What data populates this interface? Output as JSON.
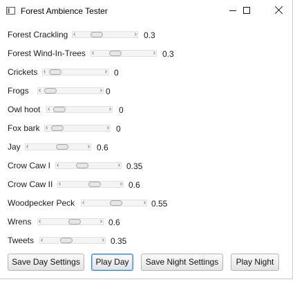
{
  "window": {
    "title": "Forest Ambience Tester",
    "controls": {
      "minimize": "minimize-icon",
      "maximize": "maximize-icon",
      "close": "close-icon"
    }
  },
  "sliders": [
    {
      "label": "Forest Crackling",
      "value": "0.3"
    },
    {
      "label": "Forest Wind-In-Trees",
      "value": "0.3"
    },
    {
      "label": "Crickets",
      "value": "0"
    },
    {
      "label": "Frogs",
      "value": "0"
    },
    {
      "label": "Owl hoot",
      "value": "0"
    },
    {
      "label": "Fox bark",
      "value": "0"
    },
    {
      "label": "Jay",
      "value": "0.6"
    },
    {
      "label": "Crow Caw I",
      "value": "0.35"
    },
    {
      "label": "Crow Caw II",
      "value": "0.6"
    },
    {
      "label": "Woodpecker Peck",
      "value": "0.55"
    },
    {
      "label": "Wrens",
      "value": "0.6"
    },
    {
      "label": "Tweets",
      "value": "0.35"
    }
  ],
  "buttons": {
    "save_day": "Save Day Settings",
    "play_day": "Play Day",
    "save_night": "Save Night Settings",
    "play_night": "Play Night"
  },
  "colors": {
    "focus_border": "#3c8fd6",
    "button_border": "#b5b5b5"
  }
}
